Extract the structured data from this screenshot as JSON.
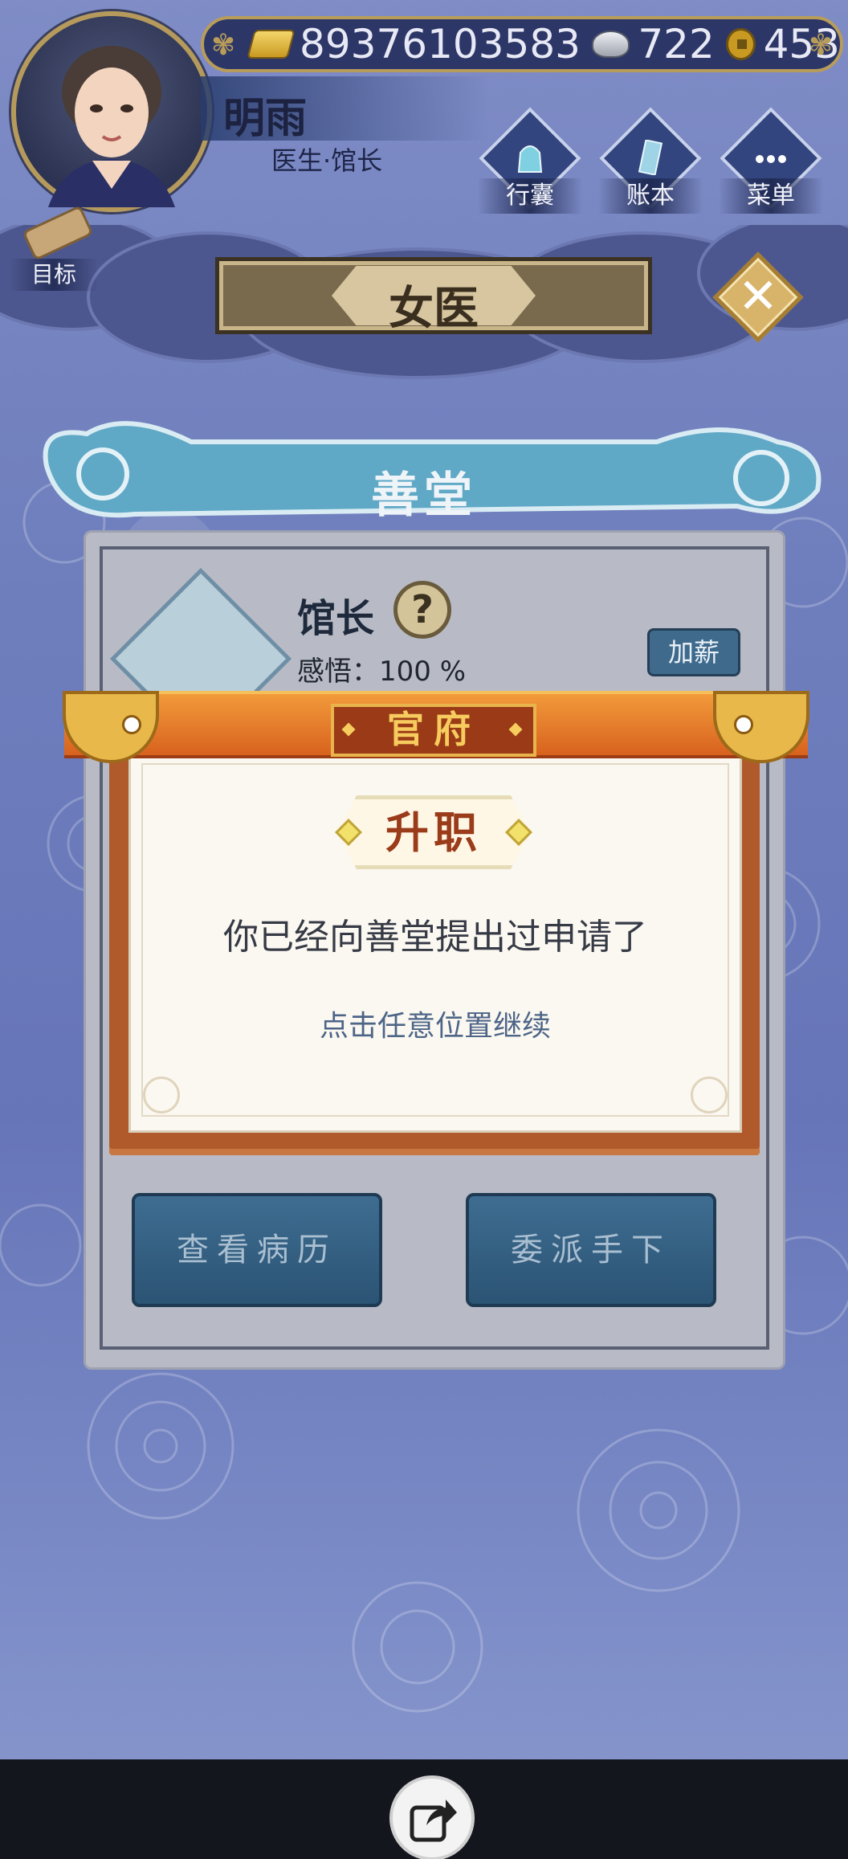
{
  "player": {
    "name": "明雨",
    "title": "医生·馆长"
  },
  "currency": {
    "gold": "89376103583",
    "silver": "722",
    "copper": "453"
  },
  "hud": {
    "bag_label": "行囊",
    "ledger_label": "账本",
    "menu_label": "菜单",
    "goal_label": "目标"
  },
  "header": {
    "title": "女医"
  },
  "hall": {
    "name": "善堂",
    "role": "馆长",
    "help": "?",
    "insight": "感悟：100 %",
    "raise_button": "加薪",
    "view_records_button": "查看病历",
    "assign_button": "委派手下"
  },
  "dialog": {
    "badge": "官府",
    "heading": "升职",
    "message": "你已经向善堂提出过申请了",
    "hint": "点击任意位置继续"
  },
  "colors": {
    "accent_orange": "#d8621e",
    "frame_brown": "#b05a2c",
    "hint_blue": "#4d6588"
  },
  "icons": {
    "share": "share-icon",
    "close": "close-icon",
    "help": "question-icon"
  }
}
